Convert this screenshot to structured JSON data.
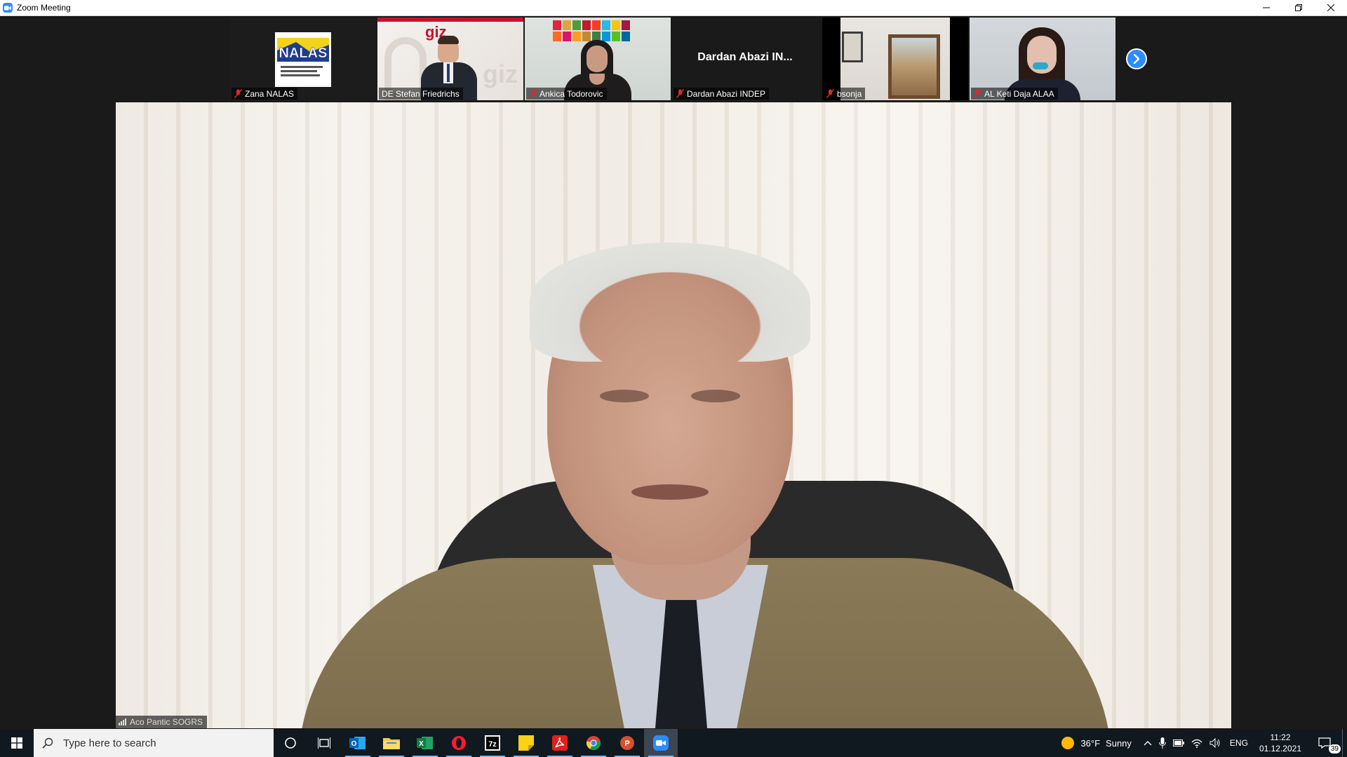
{
  "window": {
    "title": "Zoom Meeting",
    "controls": [
      "minimize",
      "restore",
      "close"
    ]
  },
  "participants": [
    {
      "name": "Zana NALAS",
      "muted": true,
      "video": "logo",
      "logo_text": "NALAS",
      "logo_subtext": "Network of Associations of Local Authorities of South-East Europe"
    },
    {
      "name": "DE Stefan Friedrichs",
      "muted": false,
      "video": "camera",
      "bg_logo_text": "giz"
    },
    {
      "name": "Ankica Todorovic",
      "muted": true,
      "video": "camera"
    },
    {
      "name": "Dardan Abazi INDEP",
      "muted": true,
      "video": "off",
      "display_text": "Dardan Abazi IN..."
    },
    {
      "name": "bsonja",
      "muted": true,
      "video": "camera"
    },
    {
      "name": "AL Keti Daja ALAA",
      "muted": true,
      "video": "camera"
    }
  ],
  "gallery": {
    "next_page_icon": "chevron-right-icon"
  },
  "active_speaker": {
    "name": "Aco Pantic SOGRS",
    "icon": "signal-bars-icon"
  },
  "taskbar": {
    "search_placeholder": "Type here to search",
    "apps": [
      "cortana",
      "task-view",
      "outlook",
      "file-explorer",
      "excel",
      "opera",
      "7zip",
      "sticky-notes",
      "acrobat",
      "chrome",
      "powerpoint",
      "zoom"
    ],
    "weather_temp": "36°F",
    "weather_desc": "Sunny",
    "language": "ENG",
    "time": "11:22",
    "date": "01.12.2021",
    "notification_count": "39"
  },
  "colors": {
    "zoom_blue": "#2d8cff",
    "taskbar_bg": "#101820",
    "meeting_bg": "#1a1a1a",
    "muted_red": "#e02828"
  }
}
